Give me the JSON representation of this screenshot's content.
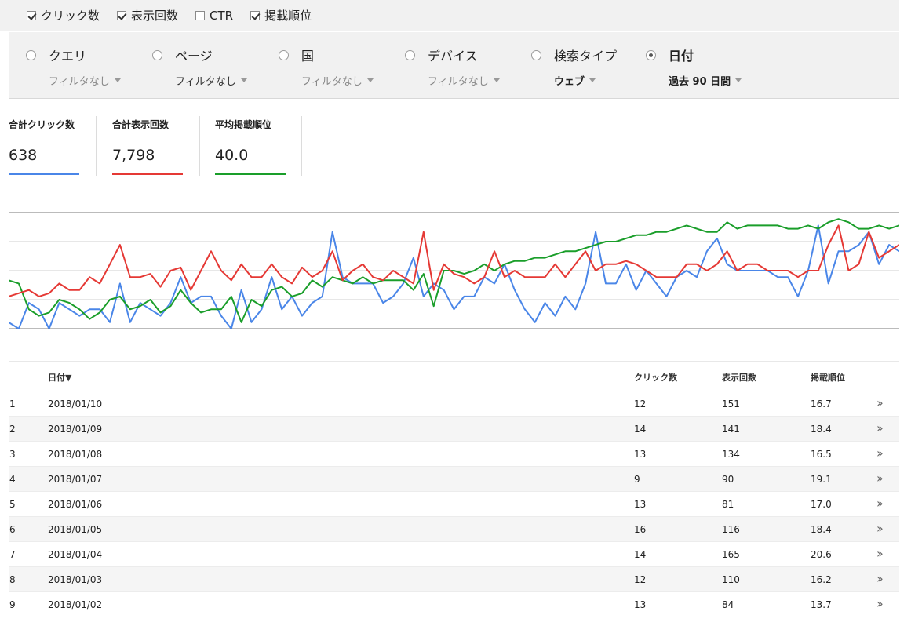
{
  "metrics": [
    {
      "label": "クリック数",
      "checked": true
    },
    {
      "label": "表示回数",
      "checked": true
    },
    {
      "label": "CTR",
      "checked": false
    },
    {
      "label": "掲載順位",
      "checked": true
    }
  ],
  "dimensions": [
    {
      "label": "クエリ",
      "filter": "フィルタなし",
      "selected": false,
      "active": false
    },
    {
      "label": "ページ",
      "filter": "フィルタなし",
      "selected": false,
      "active": true
    },
    {
      "label": "国",
      "filter": "フィルタなし",
      "selected": false,
      "active": false
    },
    {
      "label": "デバイス",
      "filter": "フィルタなし",
      "selected": false,
      "active": false
    },
    {
      "label": "検索タイプ",
      "filter": "ウェブ",
      "selected": false,
      "active": true
    },
    {
      "label": "日付",
      "filter": "過去 90 日間",
      "selected": true,
      "active": true
    }
  ],
  "totals": [
    {
      "label": "合計クリック数",
      "value": "638",
      "color": "#4a86e8"
    },
    {
      "label": "合計表示回数",
      "value": "7,798",
      "color": "#e53935"
    },
    {
      "label": "平均掲載順位",
      "value": "40.0",
      "color": "#1a9e2a"
    }
  ],
  "chart_data": {
    "type": "line",
    "grid": true,
    "series": [
      {
        "color": "#4a86e8",
        "values": [
          2,
          0,
          8,
          6,
          0,
          8,
          6,
          4,
          6,
          6,
          2,
          14,
          2,
          8,
          6,
          4,
          8,
          16,
          8,
          10,
          10,
          4,
          0,
          12,
          2,
          6,
          16,
          6,
          10,
          4,
          8,
          10,
          30,
          16,
          14,
          14,
          14,
          8,
          10,
          14,
          22,
          10,
          14,
          12,
          6,
          10,
          10,
          16,
          14,
          20,
          12,
          6,
          2,
          8,
          4,
          10,
          6,
          14,
          30,
          14,
          14,
          20,
          12,
          18,
          14,
          10,
          16,
          18,
          16,
          24,
          28,
          20,
          18,
          18,
          18,
          18,
          16,
          16,
          10,
          18,
          32,
          14,
          24,
          24,
          26,
          30,
          20,
          26,
          24
        ]
      },
      {
        "color": "#e53935",
        "values": [
          10,
          11,
          12,
          10,
          11,
          14,
          12,
          12,
          16,
          14,
          20,
          26,
          16,
          16,
          17,
          13,
          18,
          19,
          12,
          18,
          24,
          18,
          15,
          20,
          16,
          16,
          20,
          16,
          14,
          19,
          16,
          18,
          24,
          15,
          18,
          20,
          16,
          15,
          18,
          16,
          14,
          30,
          12,
          20,
          17,
          16,
          14,
          16,
          24,
          16,
          18,
          16,
          16,
          16,
          20,
          16,
          20,
          24,
          18,
          20,
          20,
          21,
          20,
          18,
          16,
          16,
          16,
          20,
          20,
          18,
          20,
          24,
          18,
          20,
          20,
          18,
          18,
          18,
          16,
          18,
          18,
          26,
          32,
          18,
          20,
          30,
          22,
          24,
          26
        ]
      },
      {
        "color": "#e53935",
        "role": "red-hidden",
        "values": []
      }
    ]
  },
  "table": {
    "headers": {
      "date": "日付▼",
      "clicks": "クリック数",
      "impressions": "表示回数",
      "position": "掲載順位"
    },
    "rows": [
      {
        "n": "1",
        "date": "2018/01/10",
        "clicks": "12",
        "impressions": "151",
        "position": "16.7"
      },
      {
        "n": "2",
        "date": "2018/01/09",
        "clicks": "14",
        "impressions": "141",
        "position": "18.4"
      },
      {
        "n": "3",
        "date": "2018/01/08",
        "clicks": "13",
        "impressions": "134",
        "position": "16.5"
      },
      {
        "n": "4",
        "date": "2018/01/07",
        "clicks": "9",
        "impressions": "90",
        "position": "19.1"
      },
      {
        "n": "5",
        "date": "2018/01/06",
        "clicks": "13",
        "impressions": "81",
        "position": "17.0"
      },
      {
        "n": "6",
        "date": "2018/01/05",
        "clicks": "16",
        "impressions": "116",
        "position": "18.4"
      },
      {
        "n": "7",
        "date": "2018/01/04",
        "clicks": "14",
        "impressions": "165",
        "position": "20.6"
      },
      {
        "n": "8",
        "date": "2018/01/03",
        "clicks": "12",
        "impressions": "110",
        "position": "16.2"
      },
      {
        "n": "9",
        "date": "2018/01/02",
        "clicks": "13",
        "impressions": "84",
        "position": "13.7"
      }
    ]
  }
}
